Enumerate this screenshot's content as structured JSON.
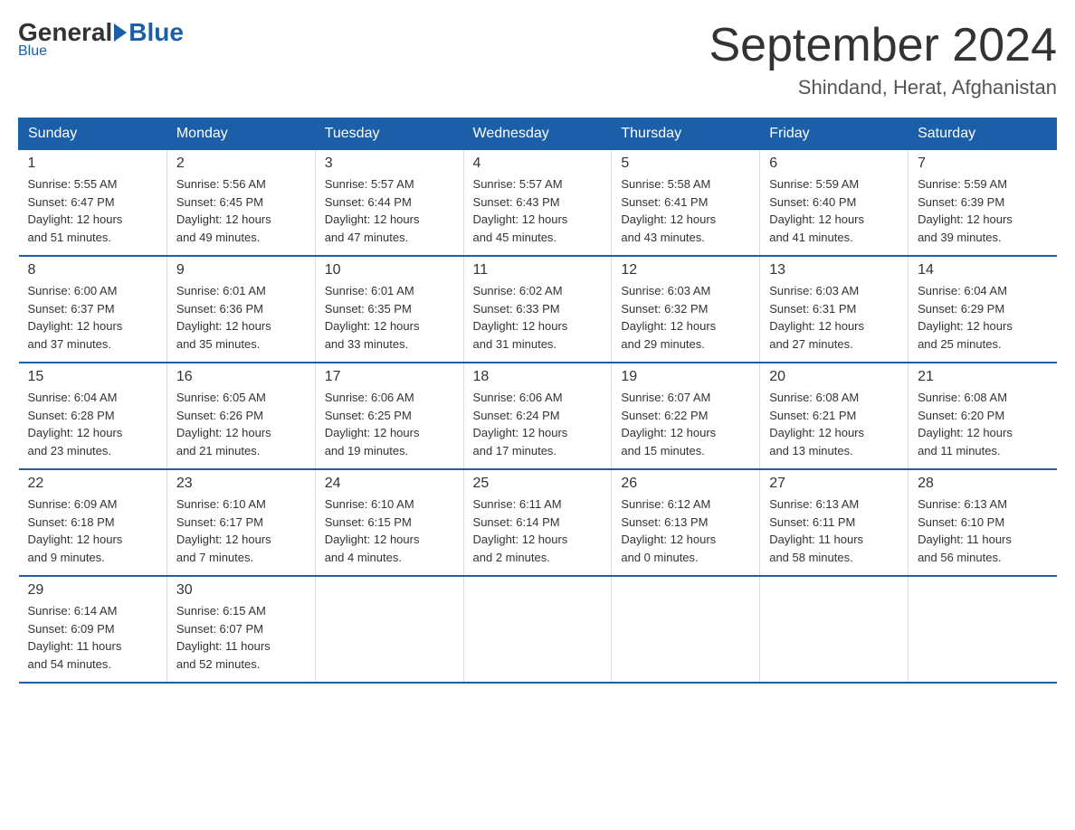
{
  "header": {
    "logo_general": "General",
    "logo_blue": "Blue",
    "month_title": "September 2024",
    "location": "Shindand, Herat, Afghanistan"
  },
  "columns": [
    "Sunday",
    "Monday",
    "Tuesday",
    "Wednesday",
    "Thursday",
    "Friday",
    "Saturday"
  ],
  "weeks": [
    [
      {
        "day": "1",
        "sunrise": "5:55 AM",
        "sunset": "6:47 PM",
        "daylight": "12 hours and 51 minutes."
      },
      {
        "day": "2",
        "sunrise": "5:56 AM",
        "sunset": "6:45 PM",
        "daylight": "12 hours and 49 minutes."
      },
      {
        "day": "3",
        "sunrise": "5:57 AM",
        "sunset": "6:44 PM",
        "daylight": "12 hours and 47 minutes."
      },
      {
        "day": "4",
        "sunrise": "5:57 AM",
        "sunset": "6:43 PM",
        "daylight": "12 hours and 45 minutes."
      },
      {
        "day": "5",
        "sunrise": "5:58 AM",
        "sunset": "6:41 PM",
        "daylight": "12 hours and 43 minutes."
      },
      {
        "day": "6",
        "sunrise": "5:59 AM",
        "sunset": "6:40 PM",
        "daylight": "12 hours and 41 minutes."
      },
      {
        "day": "7",
        "sunrise": "5:59 AM",
        "sunset": "6:39 PM",
        "daylight": "12 hours and 39 minutes."
      }
    ],
    [
      {
        "day": "8",
        "sunrise": "6:00 AM",
        "sunset": "6:37 PM",
        "daylight": "12 hours and 37 minutes."
      },
      {
        "day": "9",
        "sunrise": "6:01 AM",
        "sunset": "6:36 PM",
        "daylight": "12 hours and 35 minutes."
      },
      {
        "day": "10",
        "sunrise": "6:01 AM",
        "sunset": "6:35 PM",
        "daylight": "12 hours and 33 minutes."
      },
      {
        "day": "11",
        "sunrise": "6:02 AM",
        "sunset": "6:33 PM",
        "daylight": "12 hours and 31 minutes."
      },
      {
        "day": "12",
        "sunrise": "6:03 AM",
        "sunset": "6:32 PM",
        "daylight": "12 hours and 29 minutes."
      },
      {
        "day": "13",
        "sunrise": "6:03 AM",
        "sunset": "6:31 PM",
        "daylight": "12 hours and 27 minutes."
      },
      {
        "day": "14",
        "sunrise": "6:04 AM",
        "sunset": "6:29 PM",
        "daylight": "12 hours and 25 minutes."
      }
    ],
    [
      {
        "day": "15",
        "sunrise": "6:04 AM",
        "sunset": "6:28 PM",
        "daylight": "12 hours and 23 minutes."
      },
      {
        "day": "16",
        "sunrise": "6:05 AM",
        "sunset": "6:26 PM",
        "daylight": "12 hours and 21 minutes."
      },
      {
        "day": "17",
        "sunrise": "6:06 AM",
        "sunset": "6:25 PM",
        "daylight": "12 hours and 19 minutes."
      },
      {
        "day": "18",
        "sunrise": "6:06 AM",
        "sunset": "6:24 PM",
        "daylight": "12 hours and 17 minutes."
      },
      {
        "day": "19",
        "sunrise": "6:07 AM",
        "sunset": "6:22 PM",
        "daylight": "12 hours and 15 minutes."
      },
      {
        "day": "20",
        "sunrise": "6:08 AM",
        "sunset": "6:21 PM",
        "daylight": "12 hours and 13 minutes."
      },
      {
        "day": "21",
        "sunrise": "6:08 AM",
        "sunset": "6:20 PM",
        "daylight": "12 hours and 11 minutes."
      }
    ],
    [
      {
        "day": "22",
        "sunrise": "6:09 AM",
        "sunset": "6:18 PM",
        "daylight": "12 hours and 9 minutes."
      },
      {
        "day": "23",
        "sunrise": "6:10 AM",
        "sunset": "6:17 PM",
        "daylight": "12 hours and 7 minutes."
      },
      {
        "day": "24",
        "sunrise": "6:10 AM",
        "sunset": "6:15 PM",
        "daylight": "12 hours and 4 minutes."
      },
      {
        "day": "25",
        "sunrise": "6:11 AM",
        "sunset": "6:14 PM",
        "daylight": "12 hours and 2 minutes."
      },
      {
        "day": "26",
        "sunrise": "6:12 AM",
        "sunset": "6:13 PM",
        "daylight": "12 hours and 0 minutes."
      },
      {
        "day": "27",
        "sunrise": "6:13 AM",
        "sunset": "6:11 PM",
        "daylight": "11 hours and 58 minutes."
      },
      {
        "day": "28",
        "sunrise": "6:13 AM",
        "sunset": "6:10 PM",
        "daylight": "11 hours and 56 minutes."
      }
    ],
    [
      {
        "day": "29",
        "sunrise": "6:14 AM",
        "sunset": "6:09 PM",
        "daylight": "11 hours and 54 minutes."
      },
      {
        "day": "30",
        "sunrise": "6:15 AM",
        "sunset": "6:07 PM",
        "daylight": "11 hours and 52 minutes."
      },
      null,
      null,
      null,
      null,
      null
    ]
  ],
  "labels": {
    "sunrise": "Sunrise:",
    "sunset": "Sunset:",
    "daylight": "Daylight:"
  }
}
